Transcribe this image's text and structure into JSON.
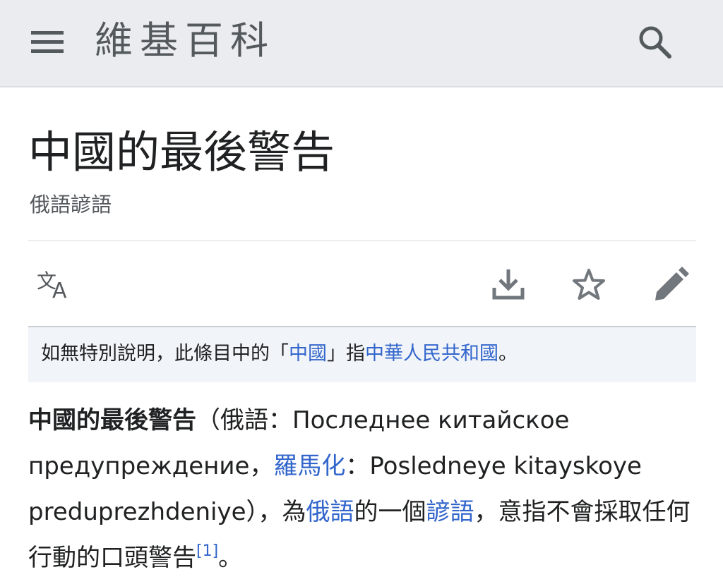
{
  "header": {
    "site_title": "維基百科",
    "menu_icon": "menu-icon",
    "search_icon": "search-icon"
  },
  "page": {
    "title": "中國的最後警告",
    "description": "俄語諺語"
  },
  "actions": {
    "language_icon": "language-icon",
    "download_icon": "download-icon",
    "star_icon": "star-icon",
    "edit_icon": "edit-icon"
  },
  "notice": {
    "prefix": "如無特別說明，此條目中的「",
    "link1": "中國",
    "middle": "」指",
    "link2": "中華人民共和國",
    "suffix": "。"
  },
  "article": {
    "lead_bold": "中國的最後警告",
    "t1": "（俄語：Последнее китайское предупреждение，",
    "link_romanization": "羅馬化",
    "t2": "：Posledneye kitayskoye preduprezhdeniye），為",
    "link_russian": "俄語",
    "t3": "的一個",
    "link_proverb": "諺語",
    "t4": "，意指不會採取任何行動的口頭警告",
    "ref": "[1]",
    "t5": "。"
  },
  "colors": {
    "header_bg": "#eaecf0",
    "link": "#3366cc",
    "icon": "#72777d",
    "notice_bg": "#f1f4f8"
  }
}
